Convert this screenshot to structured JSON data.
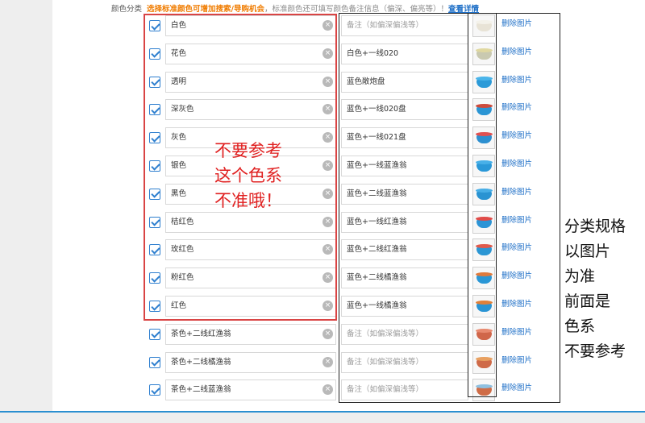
{
  "header": {
    "label": "颜色分类",
    "hint_strong": "选择标准颜色可增加搜索/导购机会",
    "hint": "，标准颜色还可填写颜色备注信息（偏深、偏亮等）！",
    "link": "查看详情"
  },
  "rows": [
    {
      "name": "白色",
      "note": "",
      "note_placeholder": "备注（如偏深偏浅等）",
      "delete": "删除图片"
    },
    {
      "name": "花色",
      "note": "白色+一线020",
      "note_placeholder": "",
      "delete": "删除图片"
    },
    {
      "name": "透明",
      "note": "蓝色敞炮盘",
      "note_placeholder": "",
      "delete": "删除图片"
    },
    {
      "name": "深灰色",
      "note": "蓝色+一线020盘",
      "note_placeholder": "",
      "delete": "删除图片"
    },
    {
      "name": "灰色",
      "note": "蓝色+一线021盘",
      "note_placeholder": "",
      "delete": "删除图片"
    },
    {
      "name": "银色",
      "note": "蓝色+一线蓝渔翁",
      "note_placeholder": "",
      "delete": "删除图片"
    },
    {
      "name": "黑色",
      "note": "蓝色+二线蓝渔翁",
      "note_placeholder": "",
      "delete": "删除图片"
    },
    {
      "name": "桔红色",
      "note": "蓝色+一线红渔翁",
      "note_placeholder": "",
      "delete": "删除图片"
    },
    {
      "name": "玫红色",
      "note": "蓝色+二线红渔翁",
      "note_placeholder": "",
      "delete": "删除图片"
    },
    {
      "name": "粉红色",
      "note": "蓝色+二线橘渔翁",
      "note_placeholder": "",
      "delete": "删除图片"
    },
    {
      "name": "红色",
      "note": "蓝色+一线橘渔翁",
      "note_placeholder": "",
      "delete": "删除图片"
    },
    {
      "name": "茶色+二线红渔翁",
      "note": "",
      "note_placeholder": "备注（如偏深偏浅等）",
      "delete": "删除图片"
    },
    {
      "name": "茶色+二线橘渔翁",
      "note": "",
      "note_placeholder": "备注（如偏深偏浅等）",
      "delete": "删除图片"
    },
    {
      "name": "茶色+二线蓝渔翁",
      "note": "",
      "note_placeholder": "备注（如偏深偏浅等）",
      "delete": "删除图片"
    }
  ],
  "thumb_colors": [
    "#e8e3d6",
    "#c9c9b0",
    "#2b9ad8",
    "#2a95d4",
    "#2c8fd0",
    "#2a98d8",
    "#2a93d2",
    "#2c94d6",
    "#2b96d4",
    "#2a97d6",
    "#2a94d4",
    "#d0664a",
    "#cf6a48",
    "#cf6c46"
  ],
  "thumb_lid_colors": [
    "#f4f2ea",
    "#e0d8a0",
    "#49b4ea",
    "#cc4b3c",
    "#e05050",
    "#48b0e8",
    "#48aee6",
    "#e04b48",
    "#e05a4c",
    "#e07a3c",
    "#e0803a",
    "#e88a70",
    "#e8a060",
    "#8fc0e0"
  ],
  "annotations": {
    "red_note": "不要参考\n这个色系\n不准哦！",
    "black_note": "分类规格\n以图片\n为准\n前面是\n色系\n不要参考"
  }
}
